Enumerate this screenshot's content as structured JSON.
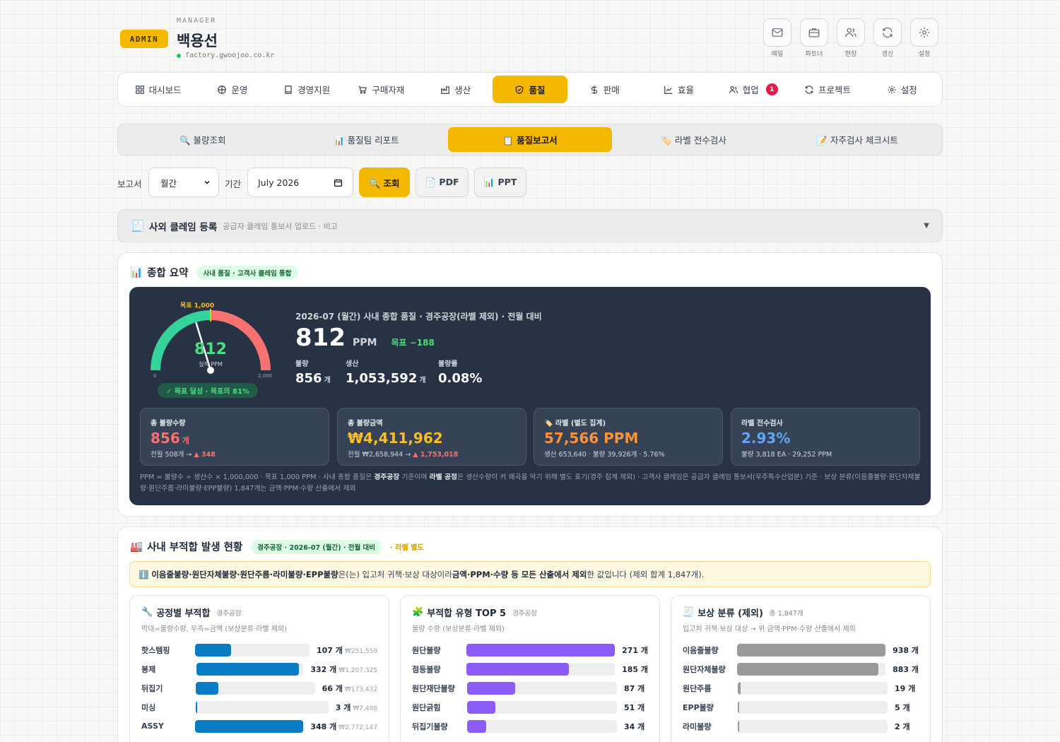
{
  "header": {
    "badge": "ADMIN",
    "role": "MANAGER",
    "user_name": "백용선",
    "domain": "factory.gwoojoo.co.kr",
    "icons": [
      {
        "name": "mail-icon",
        "label": "메일"
      },
      {
        "name": "briefcase-icon",
        "label": "파트너"
      },
      {
        "name": "users-icon",
        "label": "현장"
      },
      {
        "name": "refresh-icon",
        "label": "갱신"
      },
      {
        "name": "gear-icon",
        "label": "설정"
      }
    ]
  },
  "nav": {
    "items": [
      {
        "label": "대시보드",
        "icon": "grid-icon"
      },
      {
        "label": "운영",
        "icon": "crosshair-icon"
      },
      {
        "label": "경영지원",
        "icon": "book-icon"
      },
      {
        "label": "구매자재",
        "icon": "cart-icon"
      },
      {
        "label": "생산",
        "icon": "factory-icon"
      },
      {
        "label": "품질",
        "icon": "shield-check-icon"
      },
      {
        "label": "판매",
        "icon": "dollar-icon"
      },
      {
        "label": "효율",
        "icon": "chart-line-icon"
      },
      {
        "label": "협업",
        "icon": "team-icon",
        "badge": "1"
      },
      {
        "label": "프로젝트",
        "icon": "cycle-icon"
      },
      {
        "label": "설정",
        "icon": "gear-icon"
      }
    ],
    "active_index": 5
  },
  "subnav": {
    "items": [
      "🔍 불량조회",
      "📊 품질팀 리포트",
      "📋 품질보고서",
      "🏷️ 라벨 전수검사",
      "📝 자주검사 체크시트"
    ],
    "active_index": 2
  },
  "filters": {
    "report_label": "보고서",
    "report_value": "월간",
    "period_label": "기간",
    "period_value": "July 2026",
    "search_btn": "🔍 조회",
    "pdf_btn": "📄 PDF",
    "ppt_btn": "📊 PPT"
  },
  "claim": {
    "icon": "🧾",
    "title": "사외 클레임 등록",
    "subtitle": "공급자 클레임 통보서 업로드 · 비고",
    "caret": "▼"
  },
  "summary": {
    "icon": "📊",
    "title": "종합 요약",
    "tag": "사내 품질 · 고객사 클레임 통합",
    "gauge": {
      "target_label": "목표 1,000",
      "value_text": "812",
      "value_sub": "실적 PPM",
      "min_label": "0",
      "max_label": "2,000",
      "value": 812,
      "target": 1000,
      "max": 2000,
      "achievement": "✓ 목표 달성 · 목표의 81%",
      "color_good": "#34d399",
      "color_bad": "#f87171"
    },
    "heading": "2026-07 (월간) 사내 종합 품질 · 경주공장(라벨 제외) · 전월 대비",
    "ppm": "812",
    "ppm_unit": "PPM",
    "ppm_target_diff": "목표 −188",
    "stats": [
      {
        "label": "불량",
        "value": "856",
        "unit": "개"
      },
      {
        "label": "생산",
        "value": "1,053,592",
        "unit": "개"
      },
      {
        "label": "불량률",
        "value": "0.08%",
        "unit": ""
      }
    ],
    "kpis": [
      {
        "label": "총 불량수량",
        "value": "856",
        "unit": "개",
        "sub": "전월 508개 → ",
        "delta": "▲ 348",
        "color": "#f87171"
      },
      {
        "label": "총 불량금액",
        "value": "₩4,411,962",
        "unit": "",
        "sub": "전월 ₩2,658,944 → ",
        "delta": "▲ 1,753,018",
        "color": "#fbbf24"
      },
      {
        "label": "🏷️ 라벨 (별도 집계)",
        "value": "57,566 PPM",
        "unit": "",
        "sub": "생산 653,640 · 불량 39,926개 · 5.76%",
        "delta": "",
        "color": "#fb923c"
      },
      {
        "label": "라벨 전수검사",
        "value": "2.93%",
        "unit": "",
        "sub": "불량 3,818 EA · 29,252 PPM",
        "delta": "",
        "color": "#60a5fa"
      }
    ],
    "note_p1": "PPM = 불량수 ÷ 생산수 × 1,000,000 · 목표 1,000 PPM · 사내 종합 품질은 ",
    "note_b1": "경주공장",
    "note_p2": " 기준이며 ",
    "note_b2": "라벨 공정",
    "note_p3": "은 생산수량이 커 왜곡을 막기 위해 별도 표기(경주 집계 제외) · 고객사 클레임은 공급자 클레임 통보서(우주특수산업분) 기준 · 보상 분류(이음줄불량·원단자체불량·원단주름·라미불량·EPP불량) 1,847개는 금액·PPM·수량 산출에서 제외"
  },
  "nonconf": {
    "icon": "🏭",
    "title": "사내 부적합 발생 현황",
    "tag": "경주공장 · 2026-07 (월간) · 전월 대비",
    "extra": "· 라벨 별도",
    "info_icon": "ℹ️",
    "info_b1": "이음줄불량·원단자체불량·원단주름·라미불량·EPP불량",
    "info_p1": "은(는) 입고처 귀책·보상 대상이라 ",
    "info_b2": "금액·PPM·수량 등 모든 산출에서 제외",
    "info_p2": "한 값입니다 (제외 합계 1,847개).",
    "panels": [
      {
        "icon": "🔧",
        "title": "공정별 부적합",
        "small": "경주공장",
        "desc": "막대=불량수량, 우측=금액 (보상분류·라벨 제외)",
        "color": "#0a7cc4",
        "rows": [
          {
            "name": "핫스템핑",
            "value": 107,
            "display": "107 개",
            "amount": "₩251,559"
          },
          {
            "name": "봉제",
            "value": 332,
            "display": "332 개",
            "amount": "₩1,207,325"
          },
          {
            "name": "뒤집기",
            "value": 66,
            "display": "66 개",
            "amount": "₩173,432"
          },
          {
            "name": "미싱",
            "value": 3,
            "display": "3 개",
            "amount": "₩7,498"
          },
          {
            "name": "ASSY",
            "value": 348,
            "display": "348 개",
            "amount": "₩2,772,147"
          }
        ]
      },
      {
        "icon": "🧩",
        "title": "부적합 유형 TOP 5",
        "small": "경주공장",
        "desc": "불량 수량 (보상분류·라벨 제외)",
        "color": "#8b5cf6",
        "rows": [
          {
            "name": "원단불량",
            "value": 271,
            "display": "271 개",
            "amount": ""
          },
          {
            "name": "점등불량",
            "value": 185,
            "display": "185 개",
            "amount": ""
          },
          {
            "name": "원단재단불량",
            "value": 87,
            "display": "87 개",
            "amount": ""
          },
          {
            "name": "원단긁힘",
            "value": 51,
            "display": "51 개",
            "amount": ""
          },
          {
            "name": "뒤집기불량",
            "value": 34,
            "display": "34 개",
            "amount": ""
          }
        ]
      },
      {
        "icon": "🧾",
        "title": "보상 분류 (제외)",
        "small": "총 1,847개",
        "desc": "입고처 귀책·보상 대상 → 위 금액·PPM·수량 산출에서 제외",
        "color": "#9a9a9a",
        "rows": [
          {
            "name": "이음줄불량",
            "value": 938,
            "display": "938 개",
            "amount": ""
          },
          {
            "name": "원단자체불량",
            "value": 883,
            "display": "883 개",
            "amount": ""
          },
          {
            "name": "원단주름",
            "value": 19,
            "display": "19 개",
            "amount": ""
          },
          {
            "name": "EPP불량",
            "value": 5,
            "display": "5 개",
            "amount": ""
          },
          {
            "name": "라미불량",
            "value": 2,
            "display": "2 개",
            "amount": ""
          }
        ]
      }
    ]
  }
}
